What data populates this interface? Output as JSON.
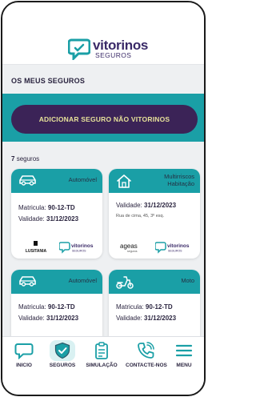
{
  "header": {
    "brand": "vitorinos",
    "brand_sub": "SEGUROS"
  },
  "page": {
    "section_title": "OS MEUS SEGUROS",
    "add_button_label": "ADICIONAR SEGURO NÃO VITORINOS",
    "count_number": "7",
    "count_label": "seguros"
  },
  "cards": [
    {
      "type": "Automóvel",
      "icon": "car-icon",
      "line1_label": "Matricula:",
      "line1_value": "90-12-TD",
      "line2_label": "Validade:",
      "line2_value": "31/12/2023",
      "insurer_logo": "LUSITANIA",
      "agency_logo": "vitorinos",
      "agency_sub": "SEGUROS"
    },
    {
      "type_line1": "Multirriscos",
      "type_line2": "Habitação",
      "icon": "house-icon",
      "line1_label": "Validade:",
      "line1_value": "31/12/2023",
      "address": "Rua de cima, 45, 3º esq.",
      "insurer_logo": "ageas",
      "insurer_sub": "seguros",
      "agency_logo": "vitorinos",
      "agency_sub": "SEGUROS"
    },
    {
      "type": "Automóvel",
      "icon": "car-icon",
      "line1_label": "Matricula:",
      "line1_value": "90-12-TD",
      "line2_label": "Validade:",
      "line2_value": "31/12/2023"
    },
    {
      "type": "Moto",
      "icon": "scooter-icon",
      "line1_label": "Matricula:",
      "line1_value": "90-12-TD",
      "line2_label": "Validade:",
      "line2_value": "31/12/2023"
    }
  ],
  "nav": [
    {
      "label": "INICIO",
      "icon": "chat-bubble-icon"
    },
    {
      "label": "SEGUROS",
      "icon": "shield-check-icon",
      "active": true
    },
    {
      "label": "SIMULAÇÃO",
      "icon": "clipboard-icon"
    },
    {
      "label": "CONTACTE-NOS",
      "icon": "phone-icon"
    },
    {
      "label": "MENU",
      "icon": "hamburger-menu-icon"
    }
  ],
  "colors": {
    "teal": "#1a9fa6",
    "purple": "#3b2357",
    "yellow_text": "#e7e29a",
    "brand_purple": "#3a2a68",
    "background": "#eef0f2"
  }
}
